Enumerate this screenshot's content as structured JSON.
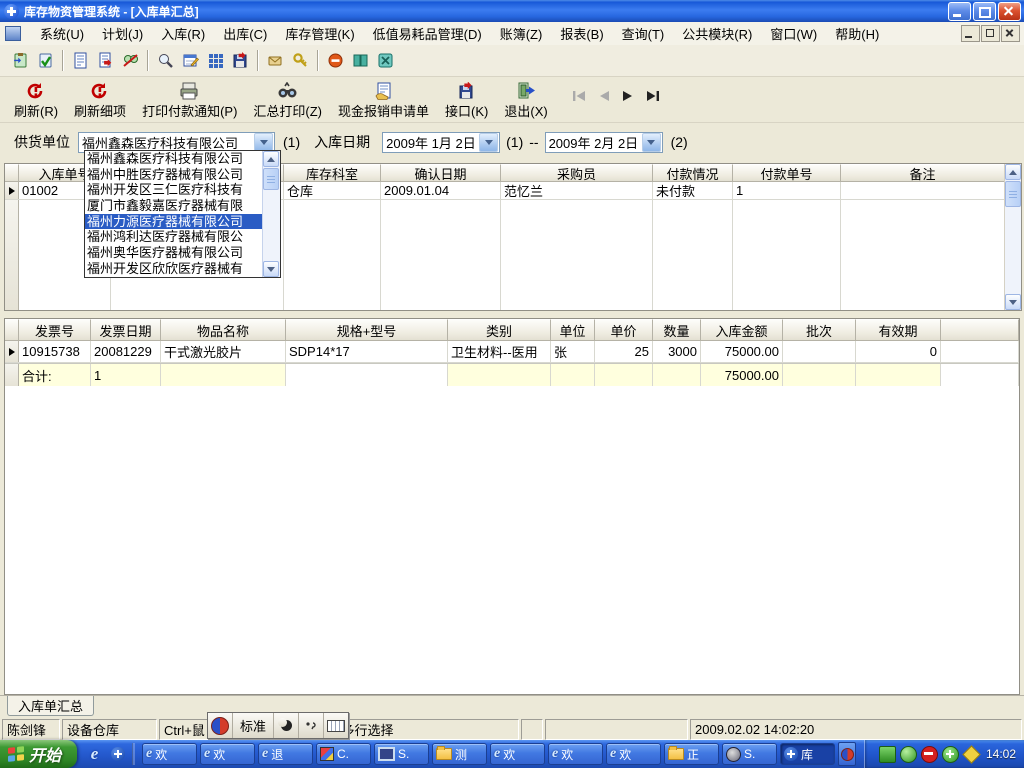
{
  "window": {
    "title": "库存物资管理系统 - [入库单汇总]"
  },
  "menu": {
    "items": [
      "系统(U)",
      "计划(J)",
      "入库(R)",
      "出库(C)",
      "库存管理(K)",
      "低值易耗品管理(D)",
      "账簿(Z)",
      "报表(B)",
      "查询(T)",
      "公共模块(R)",
      "窗口(W)",
      "帮助(H)"
    ]
  },
  "actions": {
    "labels": [
      "刷新(R)",
      "刷新细项",
      "打印付款通知(P)",
      "汇总打印(Z)",
      "现金报销申请单",
      "接口(K)",
      "退出(X)"
    ]
  },
  "filter": {
    "supplier_label": "供货单位",
    "supplier_value": "福州鑫森医疗科技有限公司",
    "supplier_hotkey": "(1)",
    "date_label": "入库日期",
    "date_from": "2009年 1月 2日",
    "date_from_hotkey": "(1)",
    "range_separator": "--",
    "date_to": "2009年 2月 2日",
    "date_to_hotkey": "(2)"
  },
  "supplier_dropdown": {
    "items": [
      "福州鑫森医疗科技有限公司",
      "福州中胜医疗器械有限公司",
      "福州开发区三仁医疗科技有",
      "厦门市鑫毅嘉医疗器械有限",
      "福州力源医疗器械有限公司",
      "福州鸿利达医疗器械有限公",
      "福州奥华医疗器械有限公司",
      "福州开发区欣欣医疗器械有"
    ],
    "selected": "福州力源医疗器械有限公司"
  },
  "orders": {
    "headers": [
      "入库单号",
      "",
      "库存科室",
      "确认日期",
      "采购员",
      "付款情况",
      "付款单号",
      "备注"
    ],
    "row": [
      "01002",
      "",
      "仓库",
      "2009.01.04",
      "范忆兰",
      "未付款",
      "1",
      ""
    ]
  },
  "details": {
    "headers": [
      "发票号",
      "发票日期",
      "物品名称",
      "规格+型号",
      "类别",
      "单位",
      "单价",
      "数量",
      "入库金额",
      "批次",
      "有效期"
    ],
    "row": [
      "10915738",
      "20081229",
      "干式激光胶片",
      "SDP14*17",
      "卫生材料--医用",
      "张",
      "25",
      "3000",
      "75000.00",
      "",
      "0"
    ],
    "total_label": "合计:",
    "total_count": "1",
    "total_amount": "75000.00"
  },
  "doc_tab": "入库单汇总",
  "statusbar": {
    "user": "陈剑锋",
    "dept": "设备仓库",
    "hint_prefix": "Ctrl+鼠",
    "hint_suffix": "--多行选择",
    "datetime": "2009.02.02 14:02:20"
  },
  "ime": {
    "mode": "标准"
  },
  "taskbar": {
    "start_label": "开始",
    "tasks": [
      "欢",
      "欢",
      "退",
      "C.",
      "S.",
      "测",
      "欢",
      "欢",
      "欢",
      "正",
      "S.",
      "库"
    ],
    "clock": "14:02"
  }
}
